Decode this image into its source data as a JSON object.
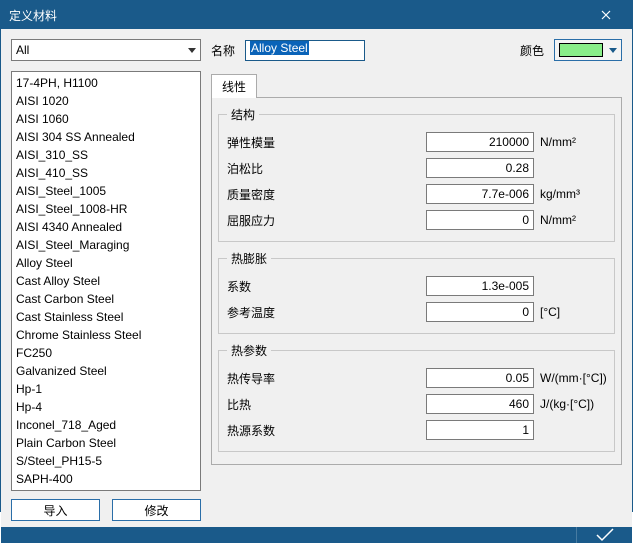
{
  "title": "定义材料",
  "filter": {
    "selected": "All"
  },
  "materials": [
    "17-4PH, H1100",
    "AISI 1020",
    "AISI 1060",
    "AISI 304 SS Annealed",
    "AISI_310_SS",
    "AISI_410_SS",
    "AISI_Steel_1005",
    "AISI_Steel_1008-HR",
    "AISI 4340 Annealed",
    "AISI_Steel_Maraging",
    "Alloy Steel",
    "Cast Alloy Steel",
    "Cast Carbon Steel",
    "Cast Stainless Steel",
    "Chrome Stainless Steel",
    "FC250",
    "Galvanized Steel",
    "Hp-1",
    "Hp-4",
    "Inconel_718_Aged",
    "Plain Carbon Steel",
    "S/Steel_PH15-5",
    "SAPH-400"
  ],
  "buttons": {
    "import": "导入",
    "modify": "修改"
  },
  "name_label": "名称",
  "name_value": "Alloy Steel",
  "color_label": "颜色",
  "color_value": "#88ee88",
  "tabs": {
    "linear": "线性"
  },
  "groups": {
    "structure": {
      "title": "结构",
      "rows": [
        {
          "label": "弹性模量",
          "value": "210000",
          "unit": "N/mm²"
        },
        {
          "label": "泊松比",
          "value": "0.28",
          "unit": ""
        },
        {
          "label": "质量密度",
          "value": "7.7e-006",
          "unit": "kg/mm³"
        },
        {
          "label": "屈服应力",
          "value": "0",
          "unit": "N/mm²"
        }
      ]
    },
    "thermal_exp": {
      "title": "热膨胀",
      "rows": [
        {
          "label": "系数",
          "value": "1.3e-005",
          "unit": ""
        },
        {
          "label": "参考温度",
          "value": "0",
          "unit": "[°C]"
        }
      ]
    },
    "thermal_param": {
      "title": "热参数",
      "rows": [
        {
          "label": "热传导率",
          "value": "0.05",
          "unit": "W/(mm·[°C])"
        },
        {
          "label": "比热",
          "value": "460",
          "unit": "J/(kg·[°C])"
        },
        {
          "label": "热源系数",
          "value": "1",
          "unit": ""
        }
      ]
    }
  }
}
